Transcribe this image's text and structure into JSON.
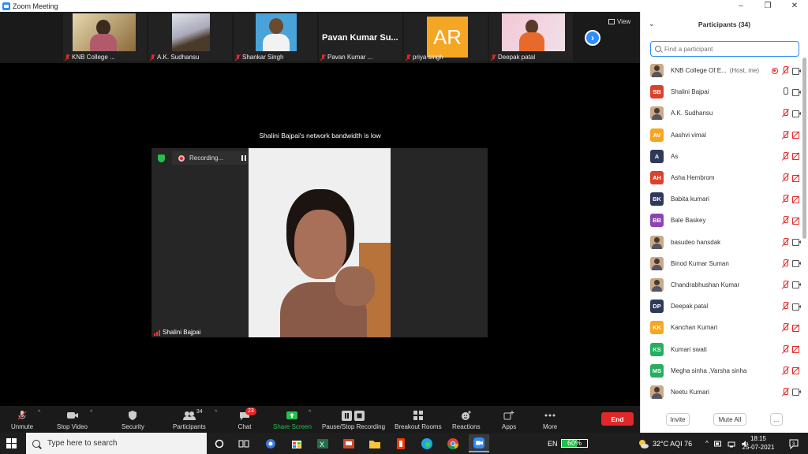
{
  "window": {
    "title": "Zoom Meeting",
    "controls": [
      "–",
      "❐",
      "✕"
    ]
  },
  "thumbnails": [
    {
      "name": "KNB College ...",
      "type": "photo"
    },
    {
      "name": "A.K. Sudhansu",
      "type": "photo"
    },
    {
      "name": "Shankar Singh",
      "type": "photo"
    },
    {
      "name": "Pavan Kumar ...",
      "type": "name",
      "display": "Pavan Kumar Su..."
    },
    {
      "name": "priya singh",
      "type": "initials",
      "display": "AR",
      "color": "#f5a623"
    },
    {
      "name": "Deepak patal",
      "type": "photo"
    }
  ],
  "view_label": "View",
  "notice": "Shalini Bajpai's network bandwidth is low",
  "recording": {
    "label": "Recording..."
  },
  "main_video": {
    "name": "Shalini Bajpai"
  },
  "toolbar": {
    "unmute": "Unmute",
    "stop_video": "Stop Video",
    "security": "Security",
    "participants": "Participants",
    "participants_count": "34",
    "chat": "Chat",
    "chat_badge": "23",
    "share_screen": "Share Screen",
    "pause_stop_recording": "Pause/Stop Recording",
    "breakout_rooms": "Breakout Rooms",
    "reactions": "Reactions",
    "apps": "Apps",
    "more": "More",
    "end": "End"
  },
  "panel": {
    "title": "Participants (34)",
    "search_placeholder": "Find a participant",
    "invite": "Invite",
    "mute_all": "Mute All",
    "more": "..."
  },
  "participants": [
    {
      "name": "KNB College Of E...",
      "tag": "(Host, me)",
      "avatar": "photo",
      "mic": "off",
      "cam": "on",
      "host": true
    },
    {
      "name": "Shalini Bajpai",
      "avatar": "SB",
      "color": "#d9432e",
      "mic": "on",
      "cam": "on"
    },
    {
      "name": "A.K. Sudhansu",
      "avatar": "photo",
      "mic": "off",
      "cam": "on"
    },
    {
      "name": "Aashvi vimal",
      "avatar": "AV",
      "color": "#f5a623",
      "mic": "off",
      "cam": "off"
    },
    {
      "name": "As",
      "avatar": "A",
      "color": "#2e3a59",
      "mic": "off",
      "cam": "off"
    },
    {
      "name": "Asha Hembrom",
      "avatar": "AH",
      "color": "#d9432e",
      "mic": "off",
      "cam": "off"
    },
    {
      "name": "Babita kumari",
      "avatar": "BK",
      "color": "#2e3a59",
      "mic": "off",
      "cam": "off"
    },
    {
      "name": "Bale Baskey",
      "avatar": "BB",
      "color": "#8e44ad",
      "mic": "off",
      "cam": "off"
    },
    {
      "name": "basudeo hansdak",
      "avatar": "photo",
      "mic": "off",
      "cam": "on"
    },
    {
      "name": "Binod Kumar Suman",
      "avatar": "photo",
      "mic": "off",
      "cam": "on"
    },
    {
      "name": "Chandrabhushan Kumar",
      "avatar": "photo",
      "mic": "off",
      "cam": "on"
    },
    {
      "name": "Deepak patal",
      "avatar": "DP",
      "color": "#2e3a59",
      "mic": "off",
      "cam": "on"
    },
    {
      "name": "Kanchan Kumari",
      "avatar": "KK",
      "color": "#f5a623",
      "mic": "off",
      "cam": "off"
    },
    {
      "name": "Kumari swati",
      "avatar": "KS",
      "color": "#27ae60",
      "mic": "off",
      "cam": "off"
    },
    {
      "name": "Megha sinha ,Varsha sinha",
      "avatar": "MS",
      "color": "#27ae60",
      "mic": "off",
      "cam": "off"
    },
    {
      "name": "Neetu Kumari",
      "avatar": "photo",
      "mic": "off",
      "cam": "on"
    }
  ],
  "taskbar": {
    "search_placeholder": "Type here to search",
    "weather": "32°C  AQI 76",
    "lang": "EN",
    "battery": "60%",
    "battery_level": 0.6,
    "time": "18:15",
    "date": "25-07-2021",
    "notif_count": "3"
  }
}
